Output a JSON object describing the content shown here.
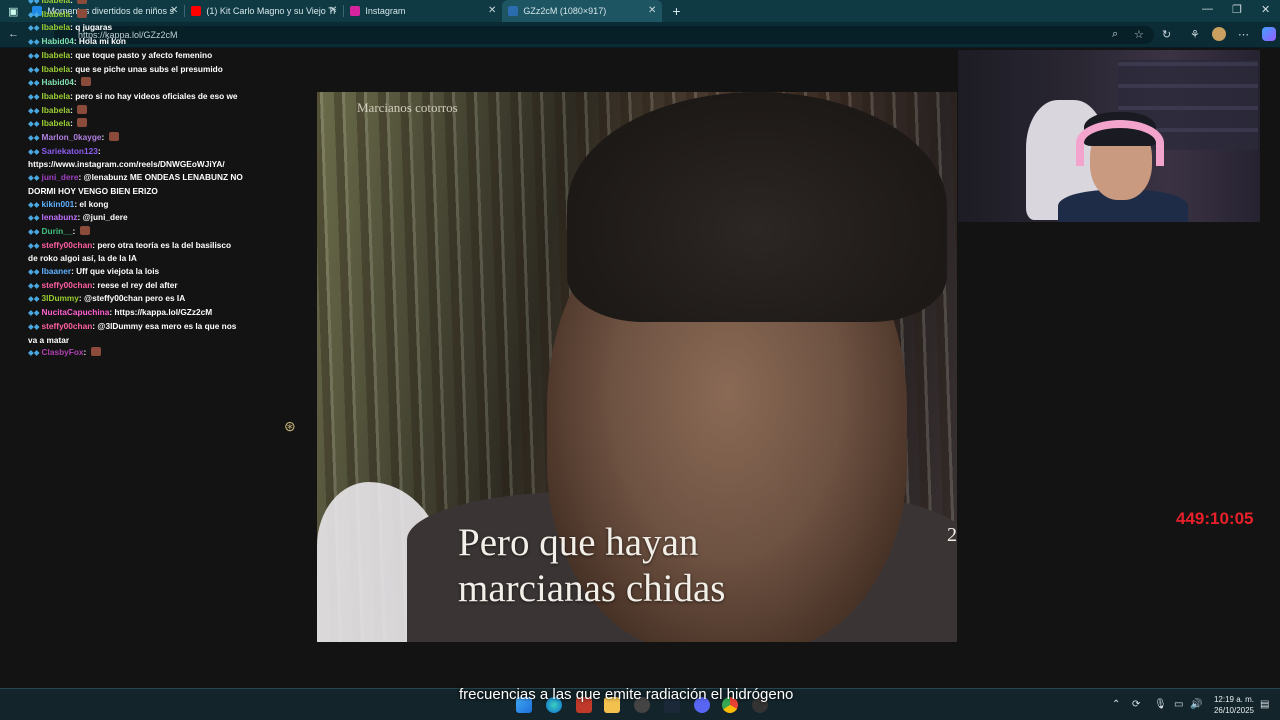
{
  "browser": {
    "tabs": [
      {
        "label": "Momentos divertidos de niños s",
        "favicon_color": "#1e88e5"
      },
      {
        "label": "(1) Kit Carlo Magno y su Viejo Tr",
        "favicon_color": "#ff0000"
      },
      {
        "label": "Instagram",
        "favicon_color": "#d6249f"
      },
      {
        "label": "GZz2cM (1080×917)",
        "favicon_color": "#2b6cb0"
      }
    ],
    "new_tab": "+",
    "url": "https://kappa.lol/GZz2cM"
  },
  "chat": {
    "messages": [
      {
        "user": "Ibabela",
        "user_color": "#9acd32",
        "text": ""
      },
      {
        "user": "Ibabela",
        "user_color": "#9acd32",
        "text": ""
      },
      {
        "user": "Ibabela",
        "user_color": "#9acd32",
        "text": "q jugaras"
      },
      {
        "user": "Habid04",
        "user_color": "#7fe0b0",
        "text": "Hola mi kon"
      },
      {
        "user": "Ibabela",
        "user_color": "#9acd32",
        "text": "que toque pasto y afecto femenino"
      },
      {
        "user": "Ibabela",
        "user_color": "#9acd32",
        "text": "que se piche unas subs el presumido"
      },
      {
        "user": "Habid04",
        "user_color": "#7fe0b0",
        "text": ""
      },
      {
        "user": "Ibabela",
        "user_color": "#9acd32",
        "text": "pero si no hay videos oficiales de eso we"
      },
      {
        "user": "Ibabela",
        "user_color": "#9acd32",
        "text": ""
      },
      {
        "user": "Ibabela",
        "user_color": "#9acd32",
        "text": ""
      },
      {
        "user": "Marlon_0kayge",
        "user_color": "#b07fe0",
        "text": ""
      },
      {
        "user": "Sariekaton123",
        "user_color": "#8a5cf0",
        "text": "https://www.instagram.com/reels/DNWGEoWJiYA/"
      },
      {
        "user": "juni_dere",
        "user_color": "#a040c0",
        "text": "@lenabunz ME ONDEAS LENABUNZ NO DORMI HOY VENGO BIEN ERIZO"
      },
      {
        "user": "kikin001",
        "user_color": "#5fb0ff",
        "text": "el kong"
      },
      {
        "user": "lenabunz",
        "user_color": "#c070ff",
        "text": "@juni_dere"
      },
      {
        "user": "Durin__",
        "user_color": "#3fbf7f",
        "text": ""
      },
      {
        "user": "steffy00chan",
        "user_color": "#ff5fa2",
        "text": "pero otra teoría es la del basilisco de roko algoi así, la de la IA"
      },
      {
        "user": "Ibaaner",
        "user_color": "#5fb0ff",
        "text": "Uff que viejota la lois"
      },
      {
        "user": "steffy00chan",
        "user_color": "#ff5fa2",
        "text": "reese el rey del after"
      },
      {
        "user": "3lDummy",
        "user_color": "#9acd32",
        "text": "@steffy00chan pero es IA"
      },
      {
        "user": "NucitaCapuchina",
        "user_color": "#ff5fd0",
        "text": "https://kappa.lol/GZz2cM"
      },
      {
        "user": "steffy00chan",
        "user_color": "#ff5fa2",
        "text": "@3lDummy esa mero es la que nos va a matar"
      },
      {
        "user": "ClasbyFox",
        "user_color": "#b040b0",
        "text": ""
      }
    ]
  },
  "video": {
    "channel_label": "Marcianos cotorros",
    "caption_line1": "Pero que hayan",
    "caption_line2": "marcianas chidas",
    "page_number": "2"
  },
  "stream": {
    "timer": "449:10:05",
    "subtitle": "frecuencias a las que emite radiación el hidrógeno"
  },
  "taskbar": {
    "time": "12:19 a. m.",
    "date": "26/10/2025"
  }
}
